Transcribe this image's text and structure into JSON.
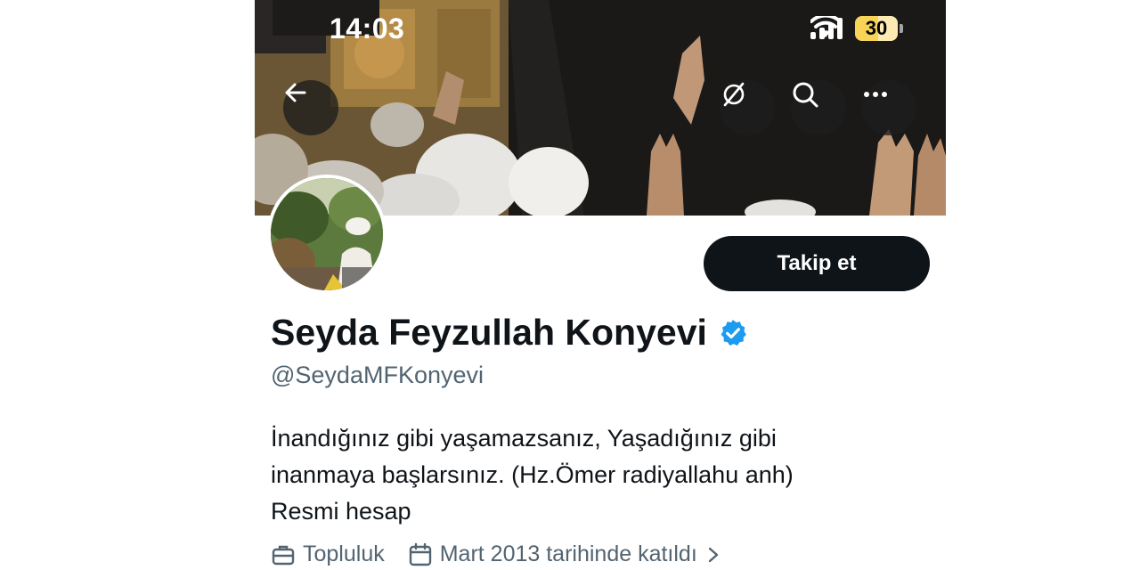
{
  "status_bar": {
    "time": "14:03",
    "battery_level": "30",
    "battery_percent": 30
  },
  "header": {
    "back_icon": "arrow-left-icon",
    "actions": [
      {
        "name": "hide-replies-icon"
      },
      {
        "name": "search-icon"
      },
      {
        "name": "more-icon"
      }
    ]
  },
  "profile": {
    "display_name": "Seyda Feyzullah Konyevi",
    "verified": true,
    "verified_color": "#1d9bf0",
    "handle": "@SeydaMFKonyevi",
    "follow_label": "Takip et",
    "bio_lines": [
      "İnandığınız gibi yaşamazsanız, Yaşadığınız gibi",
      "inanmaya başlarsınız. (Hz.Ömer radiyallahu anh)",
      "Resmi hesap"
    ],
    "meta": {
      "category": "Topluluk",
      "category_icon": "briefcase-icon",
      "joined": "Mart 2013 tarihinde katıldı",
      "joined_icon": "calendar-icon"
    }
  },
  "colors": {
    "text_primary": "#0f1419",
    "text_secondary": "#536471",
    "button_bg": "#0f1419",
    "battery": "#f7d358"
  }
}
